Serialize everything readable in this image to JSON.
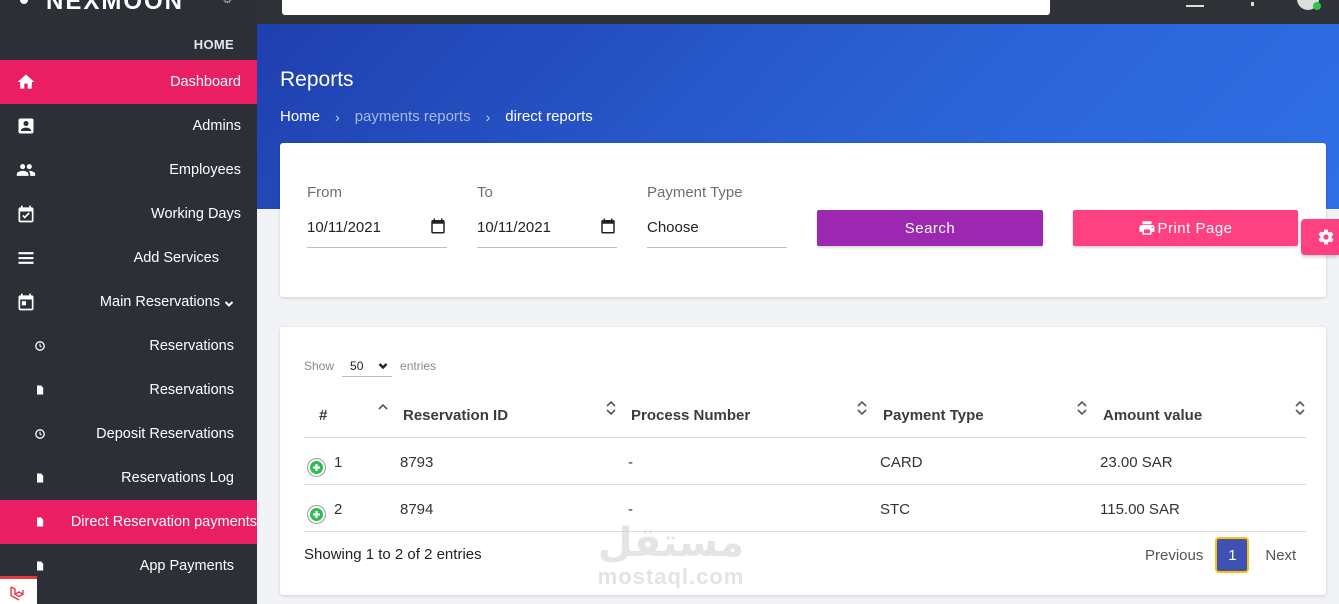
{
  "sidebar": {
    "brand": "NEXMOON",
    "section_title": "HOME",
    "items": [
      {
        "label": "Dashboard",
        "icon": "home-icon",
        "active": true
      },
      {
        "label": "Admins",
        "icon": "admin-card-icon"
      },
      {
        "label": "Employees",
        "icon": "people-icon"
      },
      {
        "label": "Working Days",
        "icon": "calendar-check-icon"
      },
      {
        "label": "Add Services",
        "icon": "list-icon"
      },
      {
        "label": "Main Reservations",
        "icon": "calendar-icon",
        "expandable": true
      },
      {
        "label": "Reservations",
        "icon": "clock-icon"
      },
      {
        "label": "Reservations",
        "icon": "file-icon"
      },
      {
        "label": "Deposit Reservations",
        "icon": "clock-icon"
      },
      {
        "label": "Reservations Log",
        "icon": "file-icon"
      },
      {
        "label": "Direct Reservation payments",
        "icon": "file-icon",
        "active": true
      },
      {
        "label": "App Payments",
        "icon": "file-icon"
      }
    ]
  },
  "header": {
    "title": "Reports",
    "breadcrumb": [
      "Home",
      "payments reports",
      "direct reports"
    ]
  },
  "filters": {
    "from_label": "From",
    "from_value": "10/11/2021",
    "to_label": "To",
    "to_value": "10/11/2021",
    "payment_type_label": "Payment Type",
    "payment_type_value": "Choose",
    "search_button": "Search",
    "print_button": "Print Page"
  },
  "table": {
    "show_label": "Show",
    "page_length": "50",
    "entries_label": "entries",
    "columns": [
      "#",
      "Reservation ID",
      "Process Number",
      "Payment Type",
      "Amount value"
    ],
    "rows": [
      {
        "index": "1",
        "reservation_id": "8793",
        "process_number": "-",
        "payment_type": "CARD",
        "amount": "23.00 SAR"
      },
      {
        "index": "2",
        "reservation_id": "8794",
        "process_number": "-",
        "payment_type": "STC",
        "amount": "115.00 SAR"
      }
    ],
    "info": "Showing 1 to 2 of 2 entries",
    "pagination": {
      "previous": "Previous",
      "current": "1",
      "next": "Next"
    }
  },
  "watermark": {
    "arabic": "مستقل",
    "latin": "mostaql.com"
  },
  "colors": {
    "sidebar_bg": "#2c2f36",
    "active_item": "#e91e63",
    "header_blue": "#2b63d6",
    "search_button": "#9c27b0",
    "print_button": "#ff4081",
    "pager_current": "#3f51b5",
    "expand_green": "#2ebd4e"
  }
}
